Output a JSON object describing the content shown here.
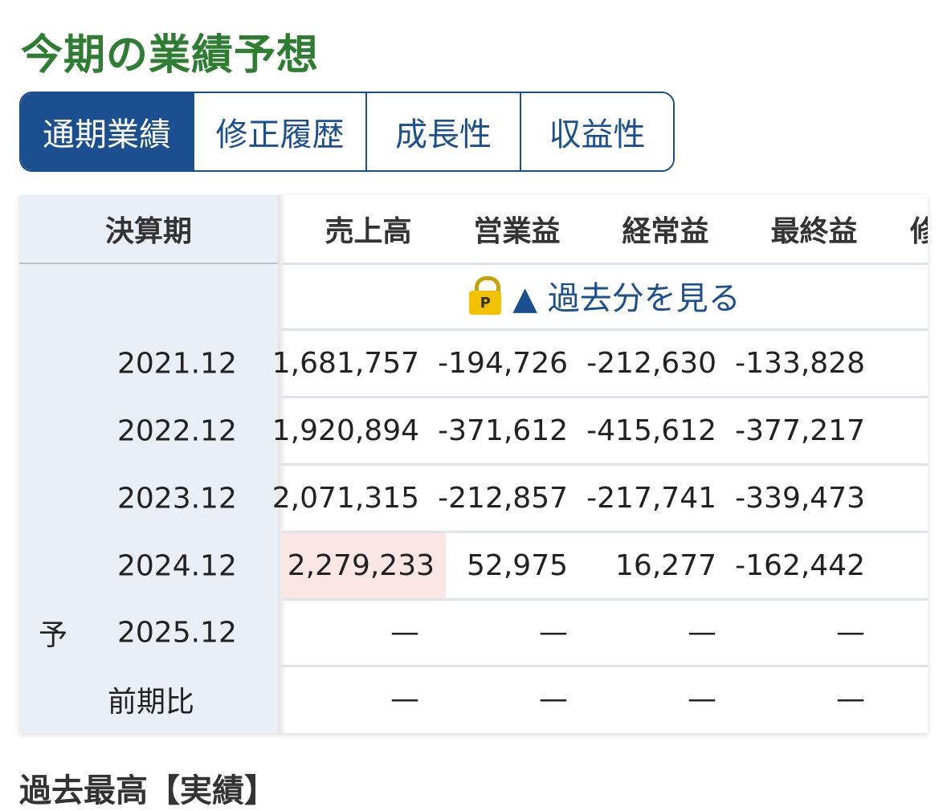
{
  "title": "今期の業績予想",
  "tabs": [
    {
      "label": "通期業績",
      "active": true
    },
    {
      "label": "修正履歴",
      "active": false
    },
    {
      "label": "成長性",
      "active": false
    },
    {
      "label": "収益性",
      "active": false
    }
  ],
  "table": {
    "period_header": "決算期",
    "columns": [
      "売上高",
      "営業益",
      "経常益",
      "最終益",
      "修"
    ],
    "past_link": "▲ 過去分を見る",
    "lock_letter": "P",
    "rows": [
      {
        "prefix": "",
        "period": "2021.12",
        "values": [
          "1,681,757",
          "-194,726",
          "-212,630",
          "-133,828"
        ]
      },
      {
        "prefix": "",
        "period": "2022.12",
        "values": [
          "1,920,894",
          "-371,612",
          "-415,612",
          "-377,217"
        ]
      },
      {
        "prefix": "",
        "period": "2023.12",
        "values": [
          "2,071,315",
          "-212,857",
          "-217,741",
          "-339,473"
        ]
      },
      {
        "prefix": "",
        "period": "2024.12",
        "values": [
          "2,279,233",
          "52,975",
          "16,277",
          "-162,442"
        ]
      },
      {
        "prefix": "予",
        "period": "2025.12",
        "values": [
          "—",
          "—",
          "—",
          "—"
        ]
      },
      {
        "prefix": "",
        "period": "前期比",
        "values": [
          "—",
          "—",
          "—",
          "—"
        ]
      }
    ]
  },
  "next_section_title": "過去最高【実績】",
  "colors": {
    "accent": "#1b4f8f",
    "title": "#2e7d32",
    "highlight": "#fbe6e6"
  }
}
